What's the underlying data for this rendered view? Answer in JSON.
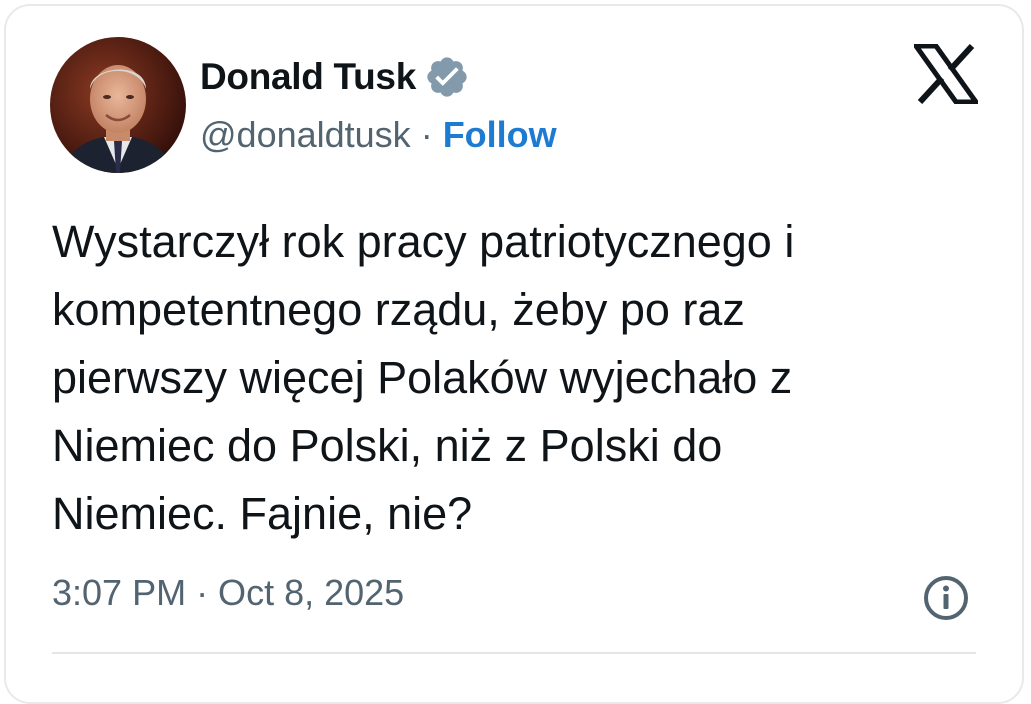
{
  "author": {
    "name": "Donald Tusk",
    "handle": "@donaldtusk",
    "separator": "·",
    "follow_label": "Follow",
    "verified_badge_color": "#829aab"
  },
  "brand": {
    "logo_icon": "x-logo-icon"
  },
  "tweet": {
    "text": "Wystarczył rok pracy patriotycznego i\nkompetentnego rządu, żeby po raz\npierwszy więcej Polaków wyjechało z\nNiemiec do Polski, niż z Polski do\nNiemiec. Fajnie, nie?",
    "timestamp": "3:07 PM · Oct 8, 2025"
  },
  "colors": {
    "text_primary": "#0f1419",
    "text_secondary": "#536471",
    "link": "#1d7bd2",
    "border": "#e7eaed"
  }
}
